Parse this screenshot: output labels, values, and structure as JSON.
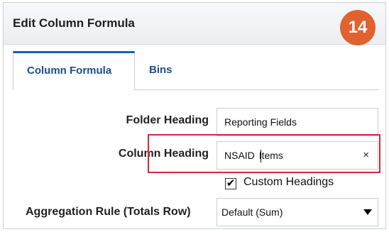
{
  "dialog": {
    "title": "Edit Column Formula",
    "step_badge": "14"
  },
  "tabs": [
    {
      "label": "Column Formula",
      "active": true
    },
    {
      "label": "Bins",
      "active": false
    }
  ],
  "form": {
    "folder_heading": {
      "label": "Folder Heading",
      "value": "Reporting Fields"
    },
    "column_heading": {
      "label": "Column Heading",
      "value_before_caret": "NSAID ",
      "value_after_caret": "Items",
      "clear_icon": "×"
    },
    "custom_headings": {
      "label": "Custom Headings",
      "checked": true,
      "check_mark": "✔"
    },
    "aggregation_rule": {
      "label": "Aggregation Rule (Totals Row)",
      "selected": "Default (Sum)"
    }
  },
  "colors": {
    "badge": "#e0622f",
    "highlight": "#d6283a",
    "tab_accent": "#1560b8",
    "tab_text": "#1a4f8a"
  }
}
